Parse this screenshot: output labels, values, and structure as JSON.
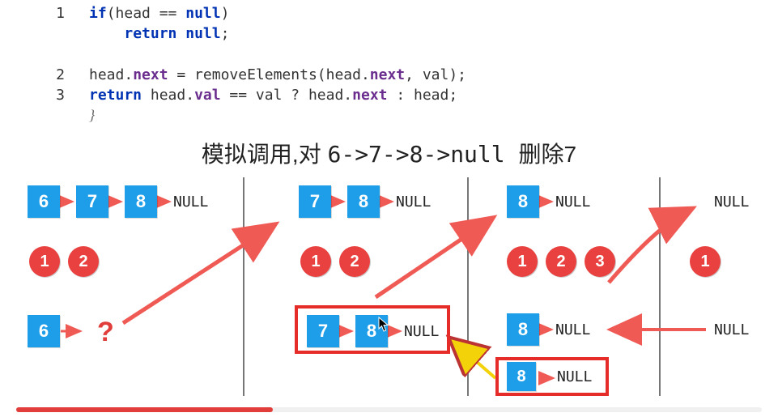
{
  "code": {
    "lines": [
      {
        "num": "1",
        "tokens": [
          {
            "t": "if",
            "c": "kw"
          },
          {
            "t": "(head == "
          },
          {
            "t": "null",
            "c": "lit"
          },
          {
            "t": ")"
          }
        ]
      },
      {
        "num": "",
        "tokens": [
          {
            "t": "    "
          },
          {
            "t": "return",
            "c": "kw"
          },
          {
            "t": " "
          },
          {
            "t": "null",
            "c": "lit"
          },
          {
            "t": ";"
          }
        ]
      },
      {
        "num": "",
        "tokens": [
          {
            "t": ""
          }
        ]
      },
      {
        "num": "2",
        "tokens": [
          {
            "t": "head."
          },
          {
            "t": "next",
            "c": "fld"
          },
          {
            "t": " = removeElements(head."
          },
          {
            "t": "next",
            "c": "fld"
          },
          {
            "t": ", val);"
          }
        ]
      },
      {
        "num": "3",
        "tokens": [
          {
            "t": "return",
            "c": "kw"
          },
          {
            "t": " head."
          },
          {
            "t": "val",
            "c": "fld"
          },
          {
            "t": " == val ? head."
          },
          {
            "t": "next",
            "c": "fld"
          },
          {
            "t": " : head;"
          }
        ]
      }
    ]
  },
  "title_cn": "模拟调用,对",
  "title_list": "6->7->8->null",
  "title_del": "删除7",
  "diagram": {
    "null_text": "NULL",
    "columns": [
      {
        "list": [
          "6",
          "7",
          "8"
        ],
        "steps": [
          "1",
          "2"
        ],
        "result": [
          "6"
        ],
        "result_tail": "?"
      },
      {
        "list": [
          "7",
          "8"
        ],
        "steps": [
          "1",
          "2"
        ],
        "result": [
          "7",
          "8"
        ],
        "result_tail": "NULL",
        "boxed": true
      },
      {
        "list": [
          "8"
        ],
        "steps": [
          "1",
          "2",
          "3"
        ],
        "result": [
          "8"
        ],
        "result_tail": "NULL"
      },
      {
        "list": [],
        "list_tail": "NULL",
        "steps": [
          "1"
        ],
        "result_tail": "NULL"
      }
    ],
    "extra_box": {
      "result": [
        "8"
      ],
      "result_tail": "NULL"
    }
  }
}
